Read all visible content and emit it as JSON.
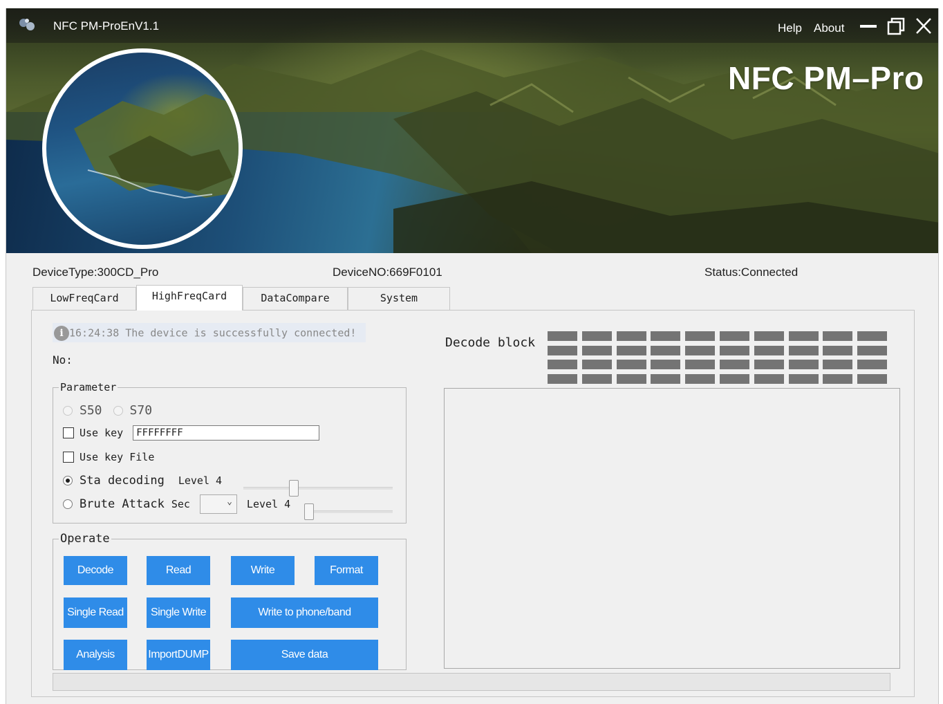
{
  "window": {
    "title": "NFC PM-ProEnV1.1",
    "menu": {
      "help": "Help",
      "about": "About"
    },
    "brand": "NFC PM–Pro"
  },
  "device": {
    "type": "DeviceType:300CD_Pro",
    "number": "DeviceNO:669F0101",
    "status": "Status:Connected"
  },
  "tabs": [
    {
      "label": "LowFreqCard",
      "active": false
    },
    {
      "label": "HighFreqCard",
      "active": true
    },
    {
      "label": "DataCompare",
      "active": false
    },
    {
      "label": "System",
      "active": false
    }
  ],
  "message": {
    "icon": "info-icon",
    "text": "16:24:38 The device is successfully connected!"
  },
  "no_label": "No:",
  "parameter": {
    "legend": "Parameter",
    "card_s50": "S50",
    "card_s70": "S70",
    "use_key_label": "Use key",
    "use_key_value": "FFFFFFFF",
    "use_key_file_label": "Use key File",
    "sta_decoding_label": "Sta decoding",
    "sta_level_label": "Level 4",
    "sta_level_value": 4,
    "brute_attack_label": "Brute Attack",
    "sec_label": "Sec",
    "brute_level_label": "Level 4",
    "brute_level_value": 4
  },
  "operate": {
    "legend": "Operate",
    "decode": "Decode",
    "read": "Read",
    "write": "Write",
    "format": "Format",
    "single_read": "Single Read",
    "single_write": "Single Write",
    "write_to_phone": "Write to phone/band",
    "analysis": "Analysis",
    "import_dump": "ImportDUMP",
    "save_data": "Save data"
  },
  "decode_block": {
    "label": "Decode block",
    "rows": 4,
    "cols": 10
  },
  "colors": {
    "button_blue": "#2f8ce8",
    "block_gray": "#747474",
    "panel_bg": "#f0f0f0"
  }
}
